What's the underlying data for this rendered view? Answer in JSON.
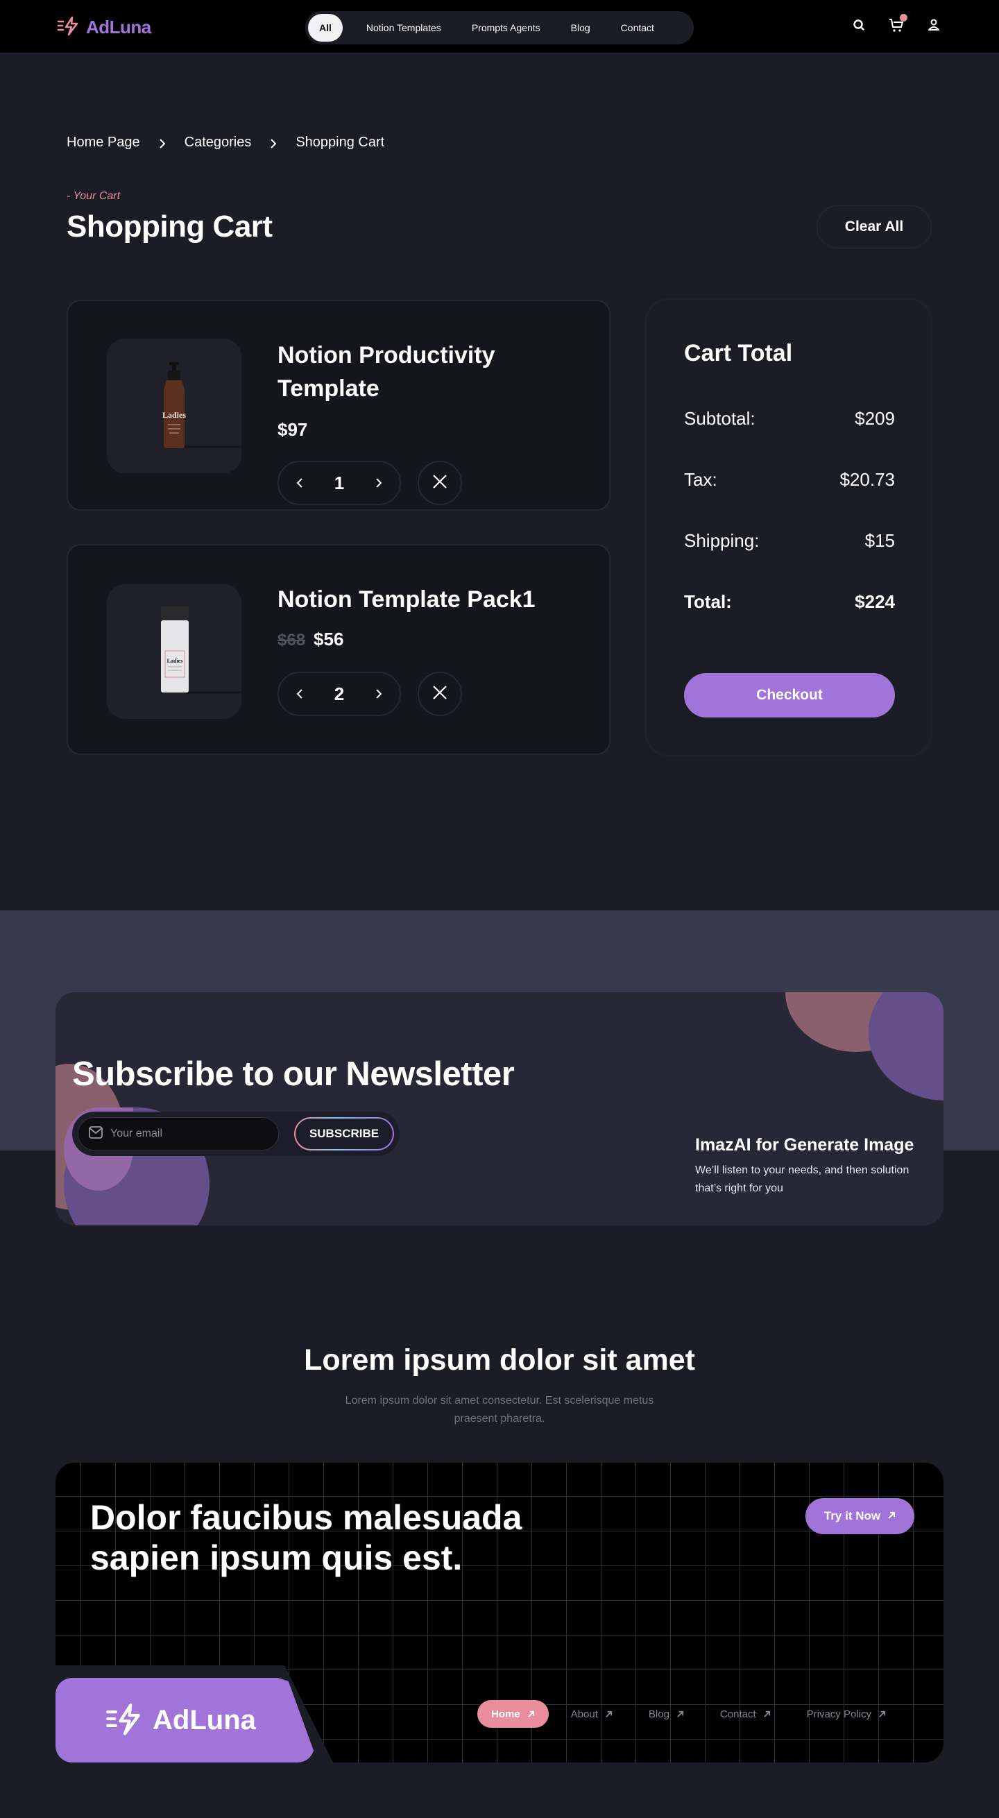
{
  "brand": {
    "name": "AdLuna",
    "accent": "#a174d9",
    "pink": "#e88d9c"
  },
  "nav": {
    "items": [
      {
        "label": "All",
        "active": true
      },
      {
        "label": "Notion Templates"
      },
      {
        "label": "Prompts Agents"
      },
      {
        "label": "Blog"
      },
      {
        "label": "Contact"
      }
    ],
    "icons": [
      "search-icon",
      "cart-icon",
      "user-icon"
    ]
  },
  "breadcrumb": [
    "Home Page",
    "Categories",
    "Shopping Cart"
  ],
  "header": {
    "eyebrow": "- Your Cart",
    "title": "Shopping Cart",
    "clear_all": "Clear All"
  },
  "cart": {
    "items": [
      {
        "title": "Notion Productivity Template",
        "price": "$97",
        "old_price": null,
        "quantity": "1",
        "image": "amber-pump-bottle"
      },
      {
        "title": "Notion Template Pack1",
        "price": "$56",
        "old_price": "$68",
        "quantity": "2",
        "image": "white-bottle"
      }
    ]
  },
  "totals": {
    "title": "Cart Total",
    "rows": [
      {
        "label": "Subtotal:",
        "value": "$209"
      },
      {
        "label": "Tax:",
        "value": "$20.73"
      },
      {
        "label": "Shipping:",
        "value": "$15"
      },
      {
        "label": "Total:",
        "value": "$224"
      }
    ],
    "checkout": "Checkout"
  },
  "newsletter": {
    "title": "Subscribe to our Newsletter",
    "email_placeholder": "Your email",
    "subscribe": "SUBSCRIBE",
    "side_title": "ImazAI for Generate Image",
    "side_text": "We’ll listen to your needs, and then solution that’s right for you"
  },
  "lorem": {
    "title": "Lorem ipsum dolor sit amet",
    "subtitle": "Lorem ipsum dolor sit amet consectetur. Est scelerisque metus praesent pharetra."
  },
  "footer": {
    "title": "Dolor faucibus malesuada sapien ipsum quis est.",
    "try_button": "Try it Now",
    "logo": "AdLuna",
    "links": [
      {
        "label": "Home",
        "active": true
      },
      {
        "label": "About"
      },
      {
        "label": "Blog"
      },
      {
        "label": "Contact"
      },
      {
        "label": "Privacy Policy"
      }
    ]
  }
}
